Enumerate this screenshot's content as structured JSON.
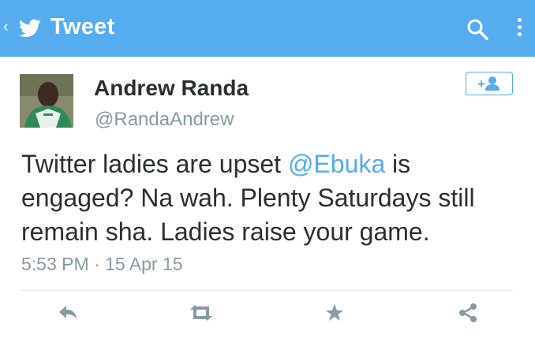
{
  "appbar": {
    "title": "Tweet",
    "back_glyph": "‹",
    "icons": {
      "logo": "twitter-bird-icon",
      "search": "search-icon",
      "more": "more-vertical-icon"
    },
    "color": "#55acee"
  },
  "tweet": {
    "author_name": "Andrew Randa",
    "author_handle": "@RandaAndrew",
    "text_before": "Twitter ladies are upset ",
    "mention": "@Ebuka",
    "text_after": " is engaged? Na wah. Plenty Saturdays still remain sha. Ladies raise your game.",
    "timestamp": "5:53 PM · 15 Apr 15"
  },
  "follow_button": {
    "icon": "add-user-icon",
    "glyph": "+"
  },
  "actions": [
    {
      "name": "reply",
      "icon": "reply-icon"
    },
    {
      "name": "retweet",
      "icon": "retweet-icon"
    },
    {
      "name": "favorite",
      "icon": "star-icon"
    },
    {
      "name": "share",
      "icon": "share-icon"
    }
  ],
  "colors": {
    "accent": "#55acee",
    "text": "#292f33",
    "secondary": "#8899a6",
    "action": "#8899a6"
  }
}
